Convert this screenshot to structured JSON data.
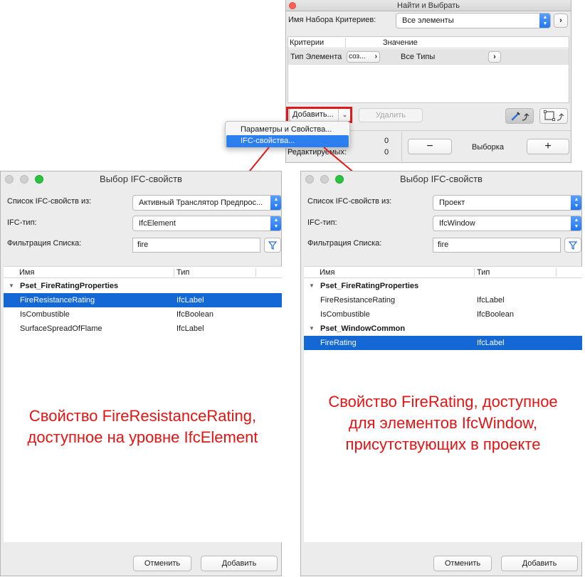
{
  "find_select": {
    "title": "Найти и Выбрать",
    "criteria_set_label": "Имя Набора Критериев:",
    "criteria_set_value": "Все элементы",
    "table_headers": [
      "Критерии",
      "Значение"
    ],
    "row": {
      "criterion": "Тип Элемента",
      "operator": "соз...",
      "value": "Все Типы"
    },
    "add_button": "Добавить...",
    "delete_button": "Удалить",
    "count1": "0",
    "editable_label": "Редактируемых:",
    "count2": "0",
    "selection_label": "Выборка"
  },
  "add_menu": {
    "items": [
      "Параметры и Свойства...",
      "IFC-свойства..."
    ]
  },
  "dialog_left": {
    "title": "Выбор IFC-свойств",
    "list_from_label": "Список IFC-свойств из:",
    "list_from_value": "Активный Транслятор Предпрос...",
    "ifc_type_label": "IFC-тип:",
    "ifc_type_value": "IfcElement",
    "filter_label": "Фильтрация Списка:",
    "filter_value": "fire",
    "col_name": "Имя",
    "col_type": "Тип",
    "rows": [
      {
        "name": "Pset_FireRatingProperties",
        "type": ""
      },
      {
        "name": "FireResistanceRating",
        "type": "IfcLabel"
      },
      {
        "name": "IsCombustible",
        "type": "IfcBoolean"
      },
      {
        "name": "SurfaceSpreadOfFlame",
        "type": "IfcLabel"
      }
    ],
    "caption_line1": "Свойство FireResistanceRating,",
    "caption_line2": "доступное на уровне IfcElement",
    "cancel": "Отменить",
    "add": "Добавить"
  },
  "dialog_right": {
    "title": "Выбор IFC-свойств",
    "list_from_label": "Список IFC-свойств из:",
    "list_from_value": "Проект",
    "ifc_type_label": "IFC-тип:",
    "ifc_type_value": "IfcWindow",
    "filter_label": "Фильтрация Списка:",
    "filter_value": "fire",
    "col_name": "Имя",
    "col_type": "Тип",
    "rows": [
      {
        "name": "Pset_FireRatingProperties",
        "type": ""
      },
      {
        "name": "FireResistanceRating",
        "type": "IfcLabel"
      },
      {
        "name": "IsCombustible",
        "type": "IfcBoolean"
      },
      {
        "name": "Pset_WindowCommon",
        "type": ""
      },
      {
        "name": "FireRating",
        "type": "IfcLabel"
      }
    ],
    "caption_line1": "Свойство FireRating, доступное",
    "caption_line2": "для элементов IfcWindow,",
    "caption_line3": "присутствующих в проекте",
    "cancel": "Отменить",
    "add": "Добавить"
  },
  "colors": {
    "selection": "#1468d6",
    "annotation_red": "#e31414",
    "menu_highlight": "#2d7ff0"
  }
}
